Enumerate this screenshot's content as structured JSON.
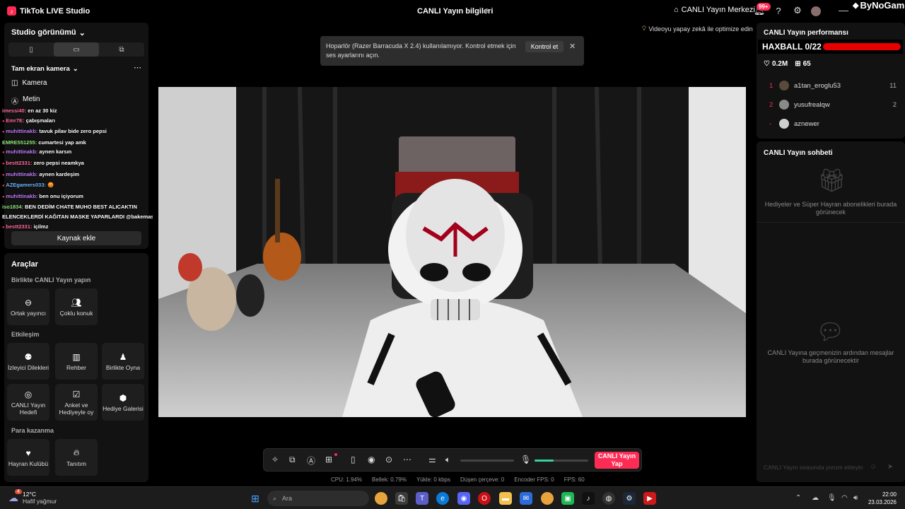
{
  "titlebar": {
    "app_title": "TikTok LIVE Studio",
    "center_title": "CANLI Yayın bilgileri",
    "live_center": "CANLI Yayın Merkezi",
    "notif_badge": "99+",
    "watermark": "ByNoGame"
  },
  "left": {
    "studio_view": "Studio görünümü",
    "scene_name": "Tam ekran kamera",
    "sources": [
      "Kamera",
      "Metin"
    ],
    "add_source": "Kaynak ekle",
    "chat": [
      {
        "user": "imessi40:",
        "msg": "en az 30 kiz",
        "color": "#ff6b9a",
        "badge": false
      },
      {
        "user": "Emr7E:",
        "msg": "çabışmaları",
        "color": "#ff6b9a",
        "badge": true
      },
      {
        "user": "muhittinakb:",
        "msg": "tavuk pilav bide zero pepsi",
        "color": "#c07dff",
        "badge": true
      },
      {
        "user": "EMRE551255:",
        "msg": "cumartesi yap amk",
        "color": "#8fe87a",
        "badge": false
      },
      {
        "user": "muhittinakb:",
        "msg": "aynen karsın",
        "color": "#c07dff",
        "badge": true
      },
      {
        "user": "bestt2331:",
        "msg": "zero pepsi neamkya",
        "color": "#ff6b9a",
        "badge": true
      },
      {
        "user": "muhittinakb:",
        "msg": "aynen kardeşim",
        "color": "#c07dff",
        "badge": true
      },
      {
        "user": "AZEgamers033:",
        "msg": "😡",
        "color": "#6ab8ff",
        "badge": true
      },
      {
        "user": "muhittinakb:",
        "msg": "ben onu içiyorum",
        "color": "#c07dff",
        "badge": true
      },
      {
        "user": "iso1834:",
        "msg": "BEN DEDİM CHATE MUHO BEST ALICAKTIN",
        "color": "#8fe87a",
        "badge": false
      },
      {
        "user": "",
        "msg": "ELENCEKLERDİ KAĞITAN MASKE YAPARLARDI @bakemask",
        "color": "#fff",
        "badge": false
      },
      {
        "user": "bestt2331:",
        "msg": "içilmz",
        "color": "#ff6b9a",
        "badge": true
      }
    ]
  },
  "tools": {
    "title": "Araçlar",
    "group1": "Birlikte CANLI Yayın yapın",
    "group2": "Etkileşim",
    "group3": "Para kazanma",
    "items": {
      "cohost": "Ortak yayıncı",
      "multiguest": "Çoklu konuk",
      "viewer_requests": "İzleyici Dilekleri",
      "guide": "Rehber",
      "play_together": "Birlikte Oyna",
      "live_goal": "CANLI Yayın Hedefi",
      "poll": "Anket ve Hediyeyle oy",
      "gift_gallery": "Hediye Galerisi",
      "fan_club": "Hayran Kulübü",
      "promote": "Tanıtım"
    }
  },
  "toast": {
    "text": "Hoparlör (Razer Barracuda X 2.4) kullanılamıyor. Kontrol etmek için ses ayarlarını açın.",
    "button": "Kontrol et"
  },
  "ai_hint": "Videoyu yapay zekâ ile optimize edin",
  "controls": {
    "go_live": "CANLI Yayın Yap",
    "mic_level": 0.35
  },
  "stats": {
    "cpu": "CPU:  1.94%",
    "memory": "Bellek:  0.79%",
    "upload": "Yükle:  0 kbps",
    "dropped": "Düşen çerçeve:  0",
    "encoder_fps": "Encoder FPS:  0",
    "fps": "FPS:  60"
  },
  "right": {
    "performance_title": "CANLI Yayın performansı",
    "haxball": "HAXBALL 0/22",
    "likes": "0.2M",
    "gifts": "65",
    "ranking": [
      {
        "rank": "1",
        "name": "a1tan_eroglu53",
        "count": "11",
        "avatar": "#5a4a3a"
      },
      {
        "rank": "2",
        "name": "yusufrealqw",
        "count": "2",
        "avatar": "#8a8a8a"
      },
      {
        "rank": "-",
        "name": "aznewer",
        "count": "",
        "avatar": "#cfcfcf"
      }
    ],
    "chat_title": "CANLI Yayın sohbeti",
    "gifts_empty": "Hediyeler ve Süper Hayran abonelikleri burada görünecek",
    "chat_empty": "CANLI Yayına geçmenizin ardından mesajlar burada görünecektir",
    "comment_placeholder": "CANLI Yayın sırasında yorum ekleyin"
  },
  "taskbar": {
    "temp": "12°C",
    "weather": "Hafif yağmur",
    "weather_badge": "4",
    "search": "Ara",
    "time": "22:00",
    "date": "23.03.2026"
  }
}
